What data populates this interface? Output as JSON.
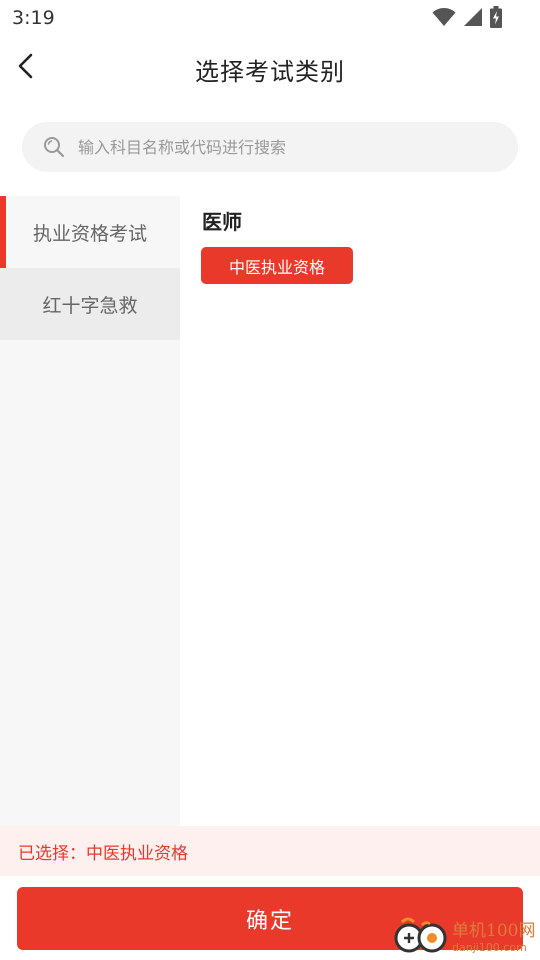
{
  "status_bar": {
    "time": "3:19",
    "icons": [
      "wifi-icon",
      "signal-icon",
      "battery-charging-icon"
    ]
  },
  "header": {
    "title": "选择考试类别",
    "back_icon": "chevron-left-icon"
  },
  "search": {
    "placeholder": "输入科目名称或代码进行搜索",
    "value": "",
    "icon": "search-icon"
  },
  "categories": [
    {
      "label": "执业资格考试",
      "active": true
    },
    {
      "label": "红十字急救",
      "active": false
    }
  ],
  "content": {
    "group_title": "医师",
    "tags": [
      {
        "label": "中医执业资格",
        "selected": true
      }
    ]
  },
  "selected_bar": {
    "text": "已选择：中医执业资格"
  },
  "confirm": {
    "label": "确定"
  },
  "watermark": {
    "line1": "单机100网",
    "line2": "danji100.com"
  },
  "colors": {
    "accent": "#e8392b",
    "selected_bg": "#fdf0ef",
    "panel_bg": "#f7f7f7"
  }
}
